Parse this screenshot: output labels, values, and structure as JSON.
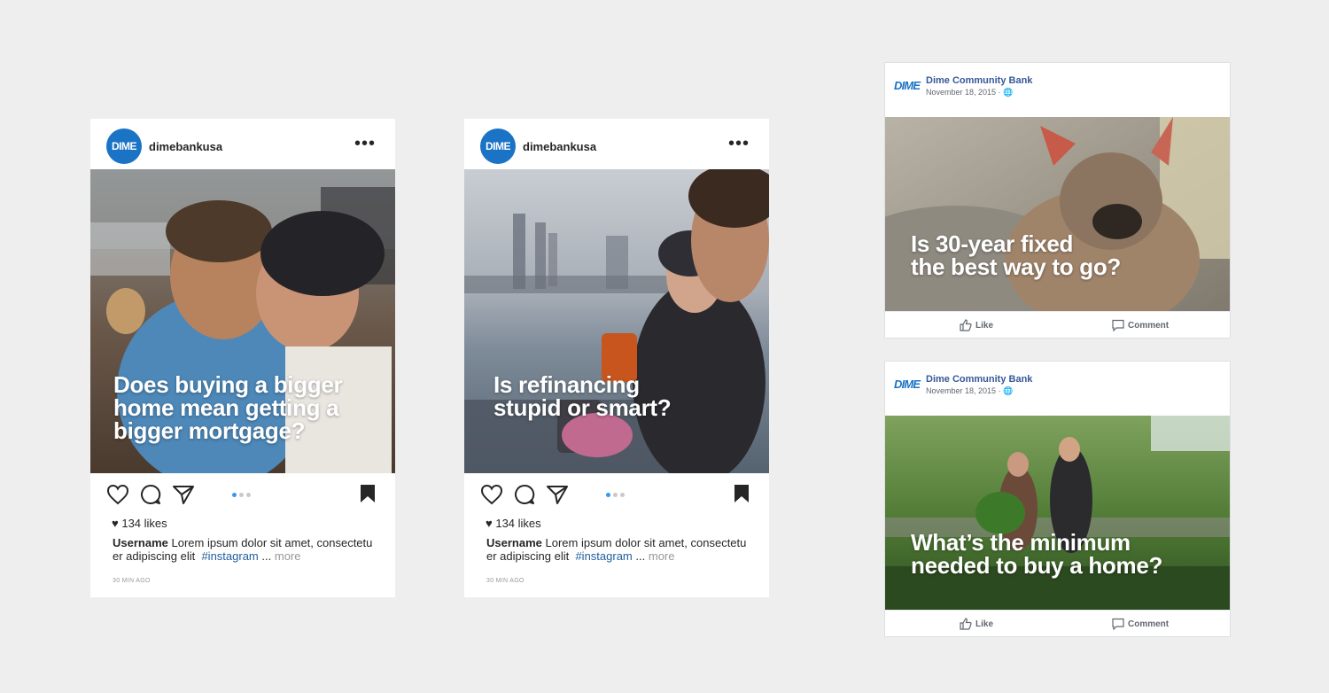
{
  "instagram_posts": [
    {
      "avatar_text": "DIME",
      "username": "dimebankusa",
      "more_icon": "more-horizontal-icon",
      "overlay_lines": [
        "Does buying a bigger",
        "home mean getting a",
        "bigger mortgage?"
      ],
      "likes": "134 likes",
      "caption_user": "Username",
      "caption_text": "Lorem ipsum dolor sit amet, consectetu er adipiscing elit",
      "caption_tag": "#instagram",
      "caption_ellipsis": "...",
      "caption_more": "more",
      "time": "30 MIN AGO"
    },
    {
      "avatar_text": "DIME",
      "username": "dimebankusa",
      "more_icon": "more-horizontal-icon",
      "overlay_lines": [
        "Is refinancing",
        "stupid or smart?"
      ],
      "likes": "134 likes",
      "caption_user": "Username",
      "caption_text": "Lorem ipsum dolor sit amet, consectetu er adipiscing elit",
      "caption_tag": "#instagram",
      "caption_ellipsis": "...",
      "caption_more": "more",
      "time": "30 MIN AGO"
    }
  ],
  "facebook_posts": [
    {
      "logo_text": "DIME",
      "page_name": "Dime Community Bank",
      "date": "November 18, 2015 ·",
      "overlay_lines": [
        "Is 30-year fixed",
        "the best way to go?"
      ],
      "like_label": "Like",
      "comment_label": "Comment"
    },
    {
      "logo_text": "DIME",
      "page_name": "Dime Community Bank",
      "date": "November 18, 2015 ·",
      "overlay_lines": [
        "What’s the minimum",
        "needed to buy a home?"
      ],
      "like_label": "Like",
      "comment_label": "Comment"
    }
  ],
  "colors": {
    "background": "#eeeeee",
    "brand_blue": "#1a73c5",
    "hashtag": "#1f5e9e",
    "fb_link": "#365899",
    "active_dot": "#3897f0"
  }
}
